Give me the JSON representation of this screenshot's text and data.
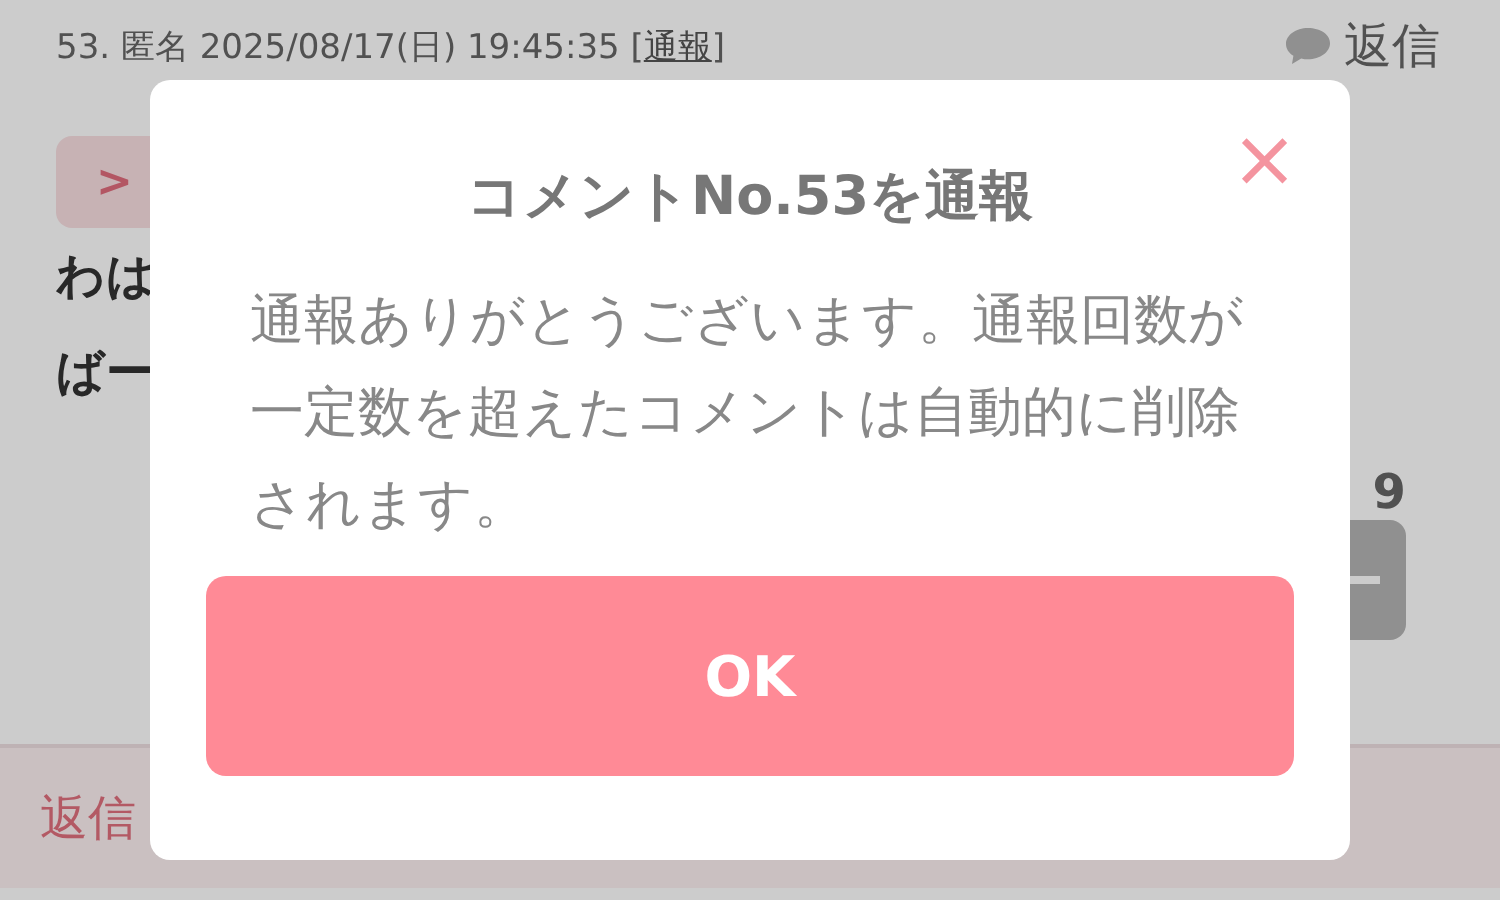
{
  "comment": {
    "header": "53. 匿名 2025/08/17(日) 19:45:35 [",
    "report_link": "通報",
    "header_end": "]",
    "reply": "返信",
    "tag": ">",
    "lines": [
      "わは",
      "ばー"
    ],
    "count": "9"
  },
  "reply_bar": {
    "label": "返信"
  },
  "dialog": {
    "title": "コメントNo.53を通報",
    "message": "通報ありがとうございます。通報回数が一定数を超えたコメントは自動的に削除されます。",
    "close": "×",
    "button": "OK"
  }
}
